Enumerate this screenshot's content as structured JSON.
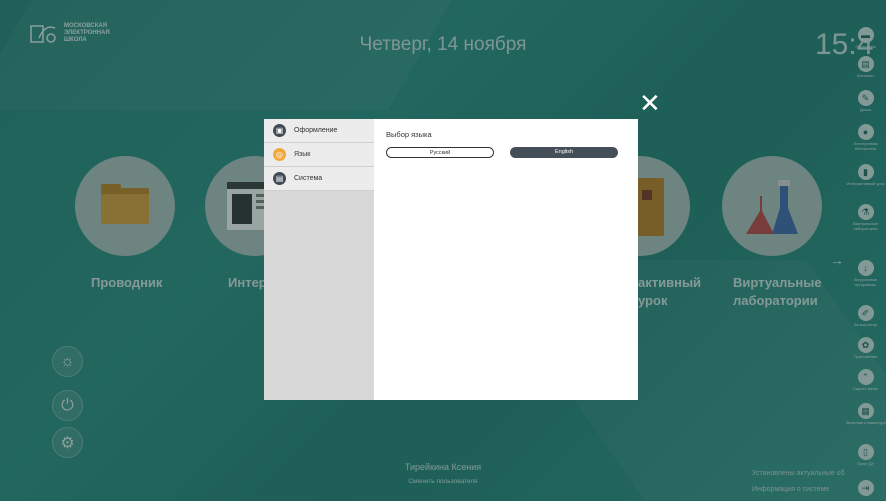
{
  "header": {
    "logo_lines": [
      "МОСКОВСКАЯ",
      "ЭЛЕКТРОННАЯ",
      "ШКОЛА"
    ],
    "date": "Четверг, 14 ноября",
    "clock": "15:4"
  },
  "tiles": [
    {
      "label": "Проводник",
      "icon": "folder-icon"
    },
    {
      "label": "Интер",
      "icon": "browser-window-icon"
    },
    {
      "label": "активный урок",
      "icon": "book-icon"
    },
    {
      "label": "Виртуальные лаборатории",
      "icon": "flask-icon"
    }
  ],
  "left_controls": [
    {
      "icon": "brightness-icon",
      "glyph": "☼"
    },
    {
      "icon": "power-icon",
      "glyph": "⏻"
    },
    {
      "icon": "settings-icon",
      "glyph": "⚙"
    }
  ],
  "user": {
    "name": "Тирейкина Ксения",
    "action": "Сменить пользователя"
  },
  "update_notice": {
    "line1": "Установлены актуальные об",
    "line2": "Информация о системе"
  },
  "rail": [
    {
      "label": "Проводник",
      "icon": "folder-icon"
    },
    {
      "label": "Интернет",
      "icon": "browser-icon"
    },
    {
      "label": "Доска",
      "icon": "pen-icon"
    },
    {
      "label": "Электронная библиотека",
      "icon": "globe-icon"
    },
    {
      "label": "Интерактивный урок",
      "icon": "book-icon"
    },
    {
      "label": "Виртуальные лаборатории",
      "icon": "flask-icon"
    },
    {
      "label": "Загрузочные программы",
      "icon": "download-icon"
    },
    {
      "label": "Калькулятор",
      "icon": "pencil-icon"
    },
    {
      "label": "Приложения",
      "icon": "apps-icon"
    },
    {
      "label": "Скрыть меню",
      "icon": "chevron-up-icon"
    },
    {
      "label": "Экранная клавиатура",
      "icon": "keyboard-icon"
    },
    {
      "label": "Пульт ДУ",
      "icon": "remote-icon"
    },
    {
      "label": "",
      "icon": "exit-icon"
    }
  ],
  "dialog": {
    "menu": [
      {
        "label": "Оформление",
        "icon": "theme-icon",
        "active": false
      },
      {
        "label": "Язык",
        "icon": "language-icon",
        "active": true
      },
      {
        "label": "Система",
        "icon": "system-icon",
        "active": false
      }
    ],
    "section_title": "Выбор языка",
    "languages": [
      {
        "label": "Русский",
        "selected": false
      },
      {
        "label": "English",
        "selected": true
      }
    ]
  },
  "colors": {
    "background": "#2f8a80",
    "dialog_sidebar": "#d8d8d8",
    "selected_language": "#454f5a",
    "language_icon": "#f2a93b"
  }
}
